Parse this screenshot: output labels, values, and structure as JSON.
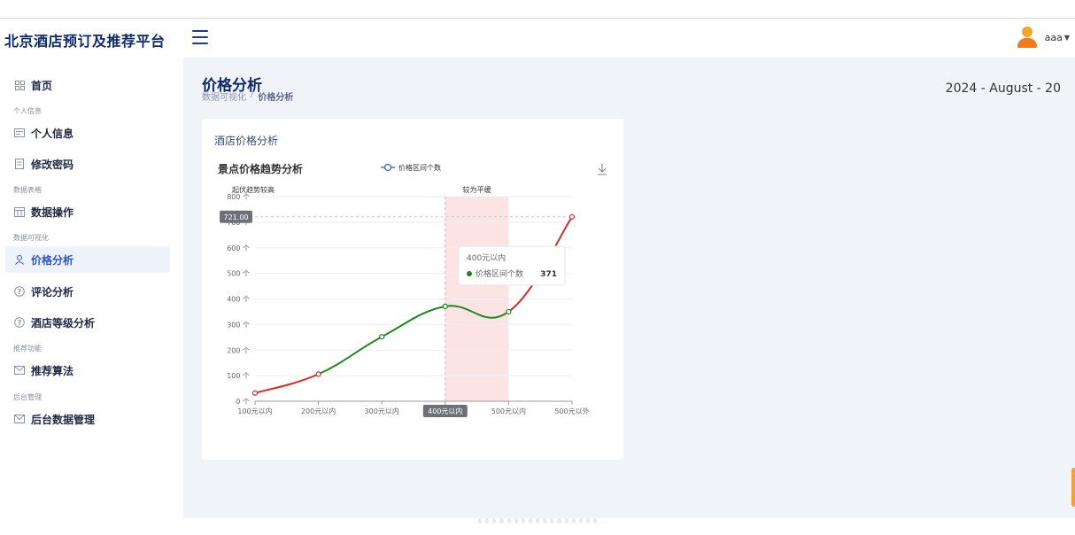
{
  "app": {
    "brand": "北京酒店预订及推荐平台",
    "user_name": "aaa"
  },
  "sidebar": {
    "home": "首页",
    "group_personal": "个人信息",
    "personal_info": "个人信息",
    "change_password": "修改密码",
    "group_data": "数据表格",
    "data_ops": "数据操作",
    "group_vis": "数据可视化",
    "price_analysis": "价格分析",
    "comment_analysis": "评论分析",
    "hotel_level": "酒店等级分析",
    "group_recommend": "推荐功能",
    "recommend_algo": "推荐算法",
    "group_admin": "后台管理",
    "backend_data": "后台数据管理"
  },
  "page": {
    "title": "价格分析",
    "breadcrumb": [
      "数据可视化",
      "/",
      "价格分析"
    ],
    "date": "2024 - August - 20",
    "card_title": "酒店价格分析"
  },
  "chart_data": {
    "type": "line",
    "title": "景点价格趋势分析",
    "legend": "价格区间个数",
    "categories": [
      "100元以内",
      "200元以内",
      "300元以内",
      "400元以内",
      "500元以内",
      "500元以外"
    ],
    "series": [
      {
        "name": "价格区间个数",
        "values": [
          32,
          106,
          252,
          371,
          350,
          721
        ]
      }
    ],
    "ylim": [
      0,
      800
    ],
    "yticks": [
      "0 个",
      "100 个",
      "200 个",
      "300 个",
      "400 个",
      "500 个",
      "600 个",
      "700 个",
      "800 个"
    ],
    "mark_area_labels": [
      "起伏趋势较高",
      "较为平缓"
    ],
    "max_line_label": "721.00",
    "highlight_x_label": "400元以内",
    "tooltip": {
      "title": "400元以内",
      "series": "价格区间个数",
      "value": "371"
    },
    "colors": {
      "up": "#d62a2a",
      "flat": "#1e8a1e",
      "band": "#fde4e4"
    }
  }
}
